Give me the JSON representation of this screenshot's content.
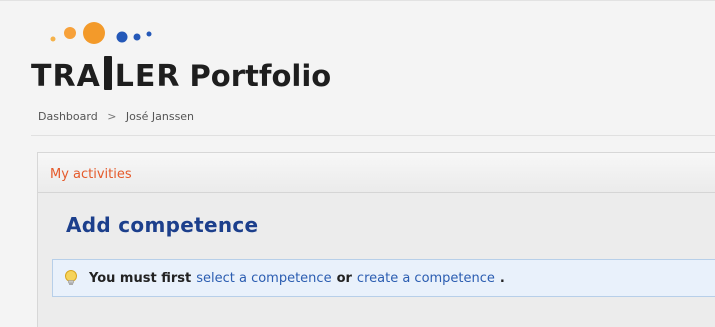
{
  "logo": {
    "word_left": "TRA",
    "word_right": "LER",
    "product": "Portfolio",
    "colors": {
      "orange": "#f39a2a",
      "blue": "#2458b8",
      "text": "#1e1e1e"
    }
  },
  "breadcrumb": {
    "items": [
      "Dashboard",
      "José Janssen"
    ],
    "separator": ">"
  },
  "panel": {
    "title": "My activities",
    "heading": "Add competence",
    "notice": {
      "icon": "lightbulb-icon",
      "prefix": "You must first",
      "link1": "select a competence",
      "conjunction": "or",
      "link2": "create a competence",
      "suffix": "."
    }
  }
}
